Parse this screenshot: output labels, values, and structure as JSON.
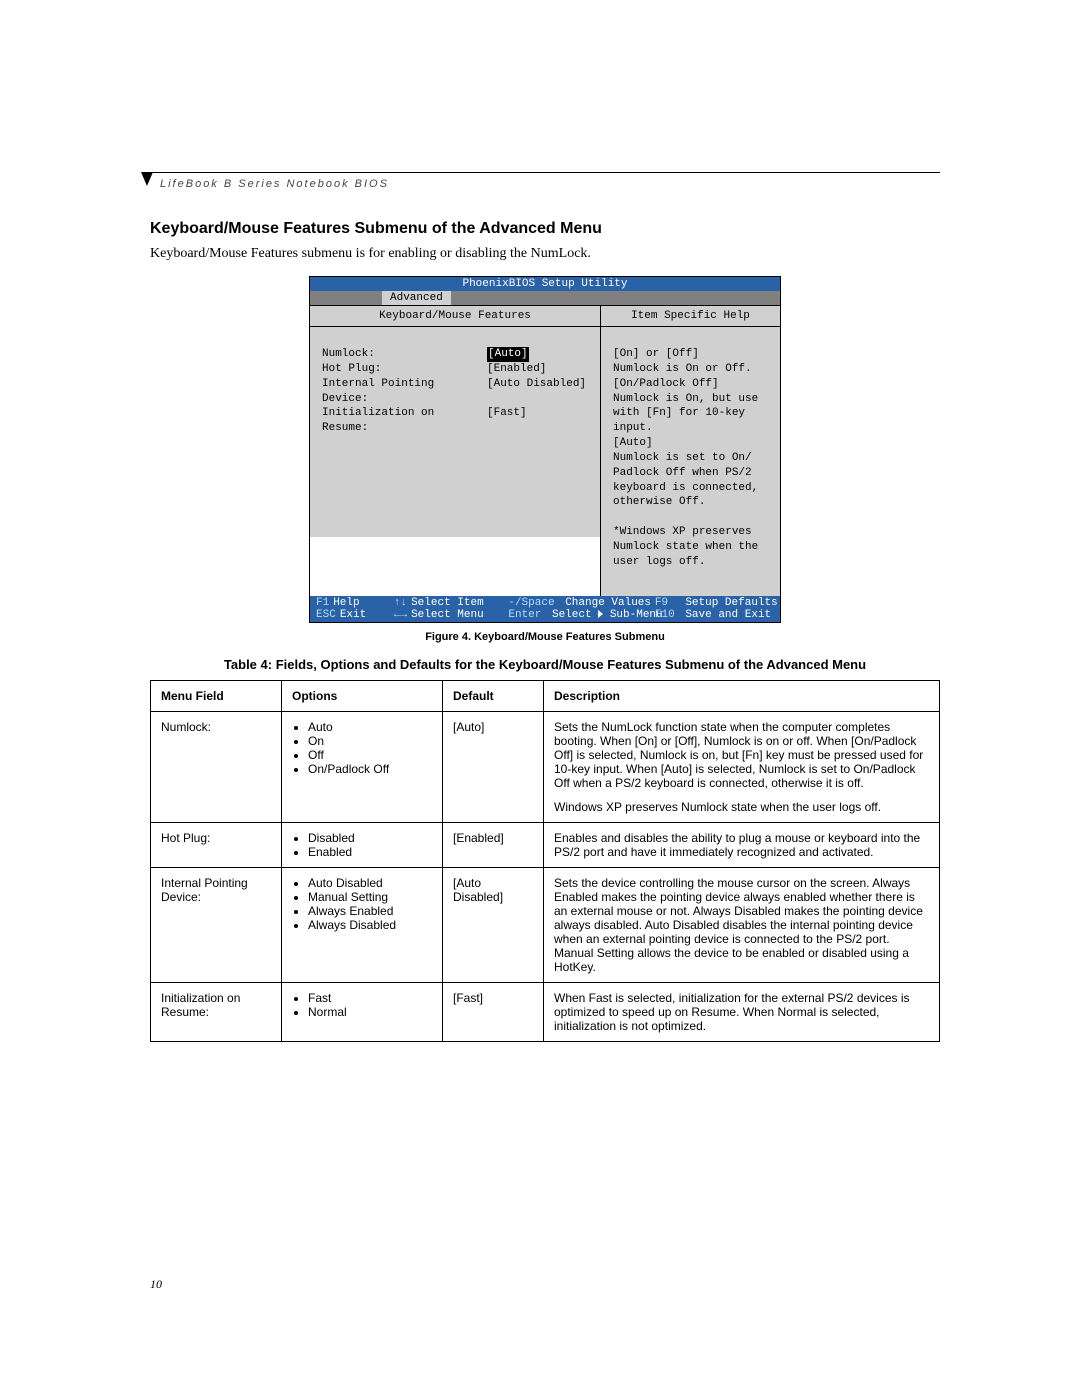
{
  "header": "LifeBook B Series Notebook BIOS",
  "section_title": "Keyboard/Mouse Features Submenu of the Advanced Menu",
  "intro": "Keyboard/Mouse Features submenu is for enabling or disabling the NumLock.",
  "bios": {
    "title": "PhoenixBIOS Setup Utility",
    "tab": "Advanced",
    "left_head": "Keyboard/Mouse Features",
    "right_head": "Item Specific Help",
    "fields": [
      {
        "label": "Numlock:",
        "value": "[Auto]",
        "selected": true
      },
      {
        "label": "Hot Plug:",
        "value": "[Enabled]"
      },
      {
        "label": "Internal Pointing Device:",
        "value": "[Auto Disabled]"
      },
      {
        "label": "Initialization on Resume:",
        "value": "[Fast]"
      }
    ],
    "help": [
      "[On] or [Off]",
      "Numlock is On or Off.",
      "[On/Padlock Off]",
      "Numlock is On, but use",
      "with [Fn] for 10-key",
      "input.",
      "[Auto]",
      "Numlock is set to On/",
      "Padlock Off when PS/2",
      "keyboard is connected,",
      "otherwise Off.",
      "",
      "*Windows XP preserves",
      "Numlock state when the",
      "user logs off."
    ],
    "footer": {
      "f1": "F1",
      "help": "Help",
      "arrows_v": "↑↓",
      "sel_item": "Select Item",
      "minus": "-/Space",
      "chg": "Change Values",
      "f9": "F9",
      "defaults": "Setup Defaults",
      "esc": "ESC",
      "exit": "Exit",
      "arrows_h": "←→",
      "sel_menu": "Select Menu",
      "enter": "Enter",
      "sub": "Select",
      "sub2": "Sub-Menu",
      "f10": "F10",
      "save": "Save and Exit"
    }
  },
  "caption": "Figure 4.  Keyboard/Mouse Features Submenu",
  "table_title": "Table 4: Fields, Options and Defaults for the Keyboard/Mouse Features Submenu of the Advanced Menu",
  "table": {
    "headers": [
      "Menu Field",
      "Options",
      "Default",
      "Description"
    ],
    "rows": [
      {
        "field": "Numlock:",
        "options": [
          "Auto",
          "On",
          "Off",
          "On/Padlock Off"
        ],
        "default": "[Auto]",
        "desc": [
          "Sets the NumLock function state when the computer completes booting. When [On] or [Off], Numlock is on or off. When [On/Padlock Off] is selected, Numlock is on, but [Fn] key must be pressed used for 10-key input. When [Auto] is selected, Numlock is set to On/Padlock Off when a PS/2 keyboard is connected, otherwise it is off.",
          "Windows XP preserves Numlock state when the user logs off."
        ]
      },
      {
        "field": "Hot Plug:",
        "options": [
          "Disabled",
          "Enabled"
        ],
        "default": "[Enabled]",
        "desc": [
          "Enables and disables the ability to plug a mouse or keyboard into the PS/2 port and have it immediately recognized and activated."
        ]
      },
      {
        "field": "Internal Pointing Device:",
        "options": [
          "Auto Disabled",
          "Manual Setting",
          "Always Enabled",
          "Always Disabled"
        ],
        "default": "[Auto Disabled]",
        "desc": [
          "Sets the device controlling the mouse cursor on the screen. Always Enabled makes the pointing device always enabled whether there is an external mouse or not. Always Disabled makes the pointing device always disabled. Auto Disabled disables the internal pointing device when an external pointing device is connected to the PS/2 port. Manual Setting allows the device to be enabled or disabled using a HotKey."
        ]
      },
      {
        "field": "Initialization on Resume:",
        "options": [
          "Fast",
          "Normal"
        ],
        "default": "[Fast]",
        "desc": [
          "When Fast is selected, initialization for the external PS/2 devices is optimized to speed up on Resume. When Normal is selected, initialization is not optimized."
        ]
      }
    ]
  },
  "pagenum": "10"
}
